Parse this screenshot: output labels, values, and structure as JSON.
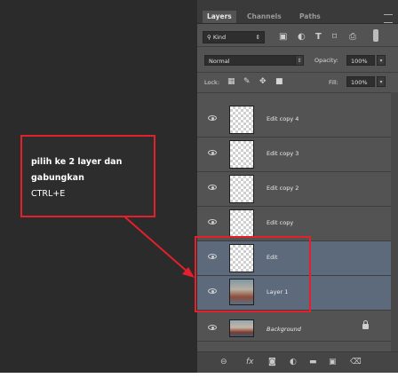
{
  "tabs": [
    "Layers",
    "Channels",
    "Paths"
  ],
  "filter": {
    "kind_label": "Kind",
    "icons": [
      "image-filter-icon",
      "adjustment-filter-icon",
      "type-filter-icon",
      "shape-filter-icon",
      "smart-object-filter-icon"
    ]
  },
  "blend": {
    "mode": "Normal",
    "opacity_label": "Opacity:",
    "opacity_value": "100%"
  },
  "lock": {
    "label": "Lock:",
    "fill_label": "Fill:",
    "fill_value": "100%"
  },
  "layers": [
    {
      "name": "Edit copy 4",
      "visible": true,
      "selected": false
    },
    {
      "name": "Edit copy 3",
      "visible": true,
      "selected": false
    },
    {
      "name": "Edit copy 2",
      "visible": true,
      "selected": false
    },
    {
      "name": "Edit copy",
      "visible": true,
      "selected": false
    },
    {
      "name": "Edit",
      "visible": true,
      "selected": true
    },
    {
      "name": "Layer 1",
      "visible": true,
      "selected": true
    },
    {
      "name": "Background",
      "visible": true,
      "selected": false,
      "locked": true
    }
  ],
  "footer_icons": [
    "link-layers-icon",
    "fx-icon",
    "layer-mask-icon",
    "adjustment-layer-icon",
    "new-group-icon",
    "new-layer-icon",
    "delete-layer-icon"
  ],
  "annotation": {
    "line1": "pilih ke 2 layer dan",
    "line2": "gabungkan",
    "line3": "CTRL+E",
    "color": "#e3202b"
  }
}
